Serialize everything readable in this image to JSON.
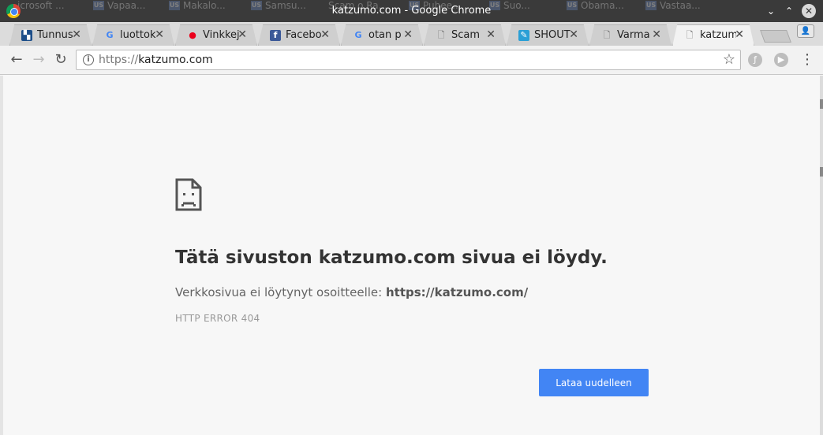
{
  "window": {
    "title": "katzumo.com - Google Chrome",
    "minimize": "⌄",
    "maximize": "⌃",
    "close": "✕"
  },
  "background_tabs": [
    {
      "label": "icrosoft ..."
    },
    {
      "label": "Vapaa..."
    },
    {
      "label": "Makalo..."
    },
    {
      "label": "Samsu..."
    },
    {
      "label": "Scam o Ra..."
    },
    {
      "label": "Puhee..."
    },
    {
      "label": "Suo..."
    },
    {
      "label": "Obama..."
    },
    {
      "label": "Vastaa..."
    }
  ],
  "tabs": [
    {
      "label": "Tunnus",
      "icon": "bank-icon",
      "glyph": "▚",
      "color": "#1d4e89",
      "close": "✕"
    },
    {
      "label": "luottok",
      "icon": "google-icon",
      "glyph": "G",
      "color": "#4285f4",
      "close": "✕"
    },
    {
      "label": "Vinkkej",
      "icon": "mastercard-icon",
      "glyph": "●",
      "color": "#eb001b",
      "close": "✕"
    },
    {
      "label": "Facebo",
      "icon": "facebook-icon",
      "glyph": "f",
      "color": "#3b5998",
      "close": "✕"
    },
    {
      "label": "otan p",
      "icon": "google-icon",
      "glyph": "G",
      "color": "#4285f4",
      "close": "✕"
    },
    {
      "label": "Scam",
      "icon": "document-icon",
      "glyph": "🗋",
      "color": "#666666",
      "close": "✕"
    },
    {
      "label": "SHOUT",
      "icon": "shout-icon",
      "glyph": "✎",
      "color": "#2a9fd6",
      "close": "✕"
    },
    {
      "label": "Varma",
      "icon": "document-icon",
      "glyph": "🗋",
      "color": "#666666",
      "close": "✕"
    },
    {
      "label": "katzum",
      "icon": "document-icon",
      "glyph": "🗋",
      "color": "#666666",
      "close": "✕",
      "active": true
    }
  ],
  "toolbar": {
    "back": "←",
    "forward": "→",
    "reload": "↻",
    "url_scheme": "https://",
    "url_host": "katzumo.com",
    "star": "☆",
    "menu": "⋮"
  },
  "error_page": {
    "title": "Tätä sivuston katzumo.com sivua ei löydy.",
    "description_prefix": "Verkkosivua ei löytynyt osoitteelle:",
    "description_url": "https://katzumo.com/",
    "error_code": "HTTP ERROR 404",
    "reload_label": "Lataa uudelleen"
  },
  "colors": {
    "accent": "#4285f4",
    "titlebar": "#3a3a3a"
  }
}
